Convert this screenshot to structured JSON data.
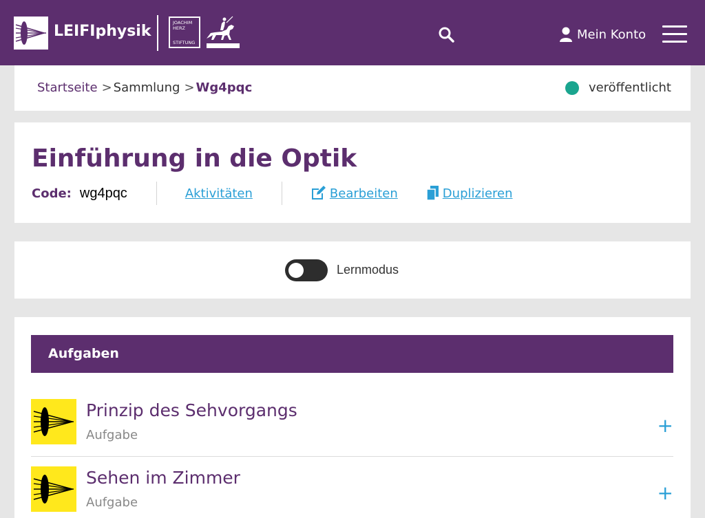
{
  "header": {
    "brand": "LEIFIphysik",
    "partner_lines": [
      "JOACHIM",
      "HERZ",
      "STIFTUNG"
    ],
    "account_label": "Mein Konto",
    "icons": [
      "lens-logo-icon",
      "horse-rider-logo-icon",
      "search-icon",
      "user-icon",
      "hamburger-menu-icon"
    ]
  },
  "breadcrumb": {
    "items": [
      "Startseite",
      "Sammlung"
    ],
    "current": "Wg4pqc",
    "separator": ">"
  },
  "status": {
    "label": "veröffentlicht",
    "color": "#1aa58f"
  },
  "collection": {
    "title": "Einführung in die Optik",
    "code_label": "Code:",
    "code_value": "wg4pqc",
    "activities_label": "Aktivitäten",
    "edit_label": "Bearbeiten",
    "duplicate_label": "Duplizieren"
  },
  "mode": {
    "label": "Lernmodus",
    "enabled": false
  },
  "tasks": {
    "header": "Aufgaben",
    "items": [
      {
        "title": "Prinzip des Sehvorgangs",
        "type": "Aufgabe"
      },
      {
        "title": "Sehen im Zimmer",
        "type": "Aufgabe"
      }
    ]
  },
  "colors": {
    "brand": "#5c2e6e",
    "link": "#2a9fd6",
    "thumb": "#ffe81c"
  }
}
